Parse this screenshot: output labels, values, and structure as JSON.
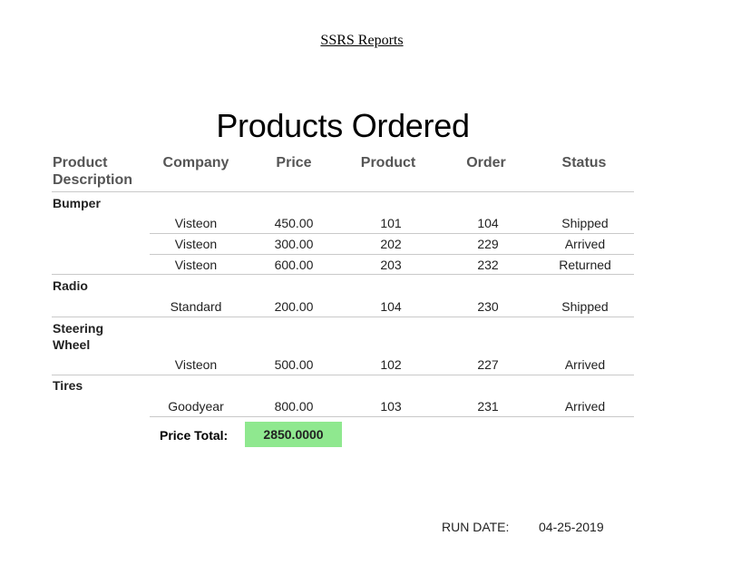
{
  "header": {
    "link_text": "SSRS Reports"
  },
  "report": {
    "title": "Products Ordered",
    "columns": {
      "description": "Product Description",
      "company": "Company",
      "price": "Price",
      "product": "Product",
      "order": "Order",
      "status": "Status"
    },
    "groups": [
      {
        "name": "Bumper",
        "rows": [
          {
            "company": "Visteon",
            "price": "450.00",
            "product": "101",
            "order": "104",
            "status": "Shipped"
          },
          {
            "company": "Visteon",
            "price": "300.00",
            "product": "202",
            "order": "229",
            "status": "Arrived"
          },
          {
            "company": "Visteon",
            "price": "600.00",
            "product": "203",
            "order": "232",
            "status": "Returned"
          }
        ]
      },
      {
        "name": "Radio",
        "rows": [
          {
            "company": "Standard",
            "price": "200.00",
            "product": "104",
            "order": "230",
            "status": "Shipped"
          }
        ]
      },
      {
        "name": "Steering Wheel",
        "rows": [
          {
            "company": "Visteon",
            "price": "500.00",
            "product": "102",
            "order": "227",
            "status": "Arrived"
          }
        ]
      },
      {
        "name": "Tires",
        "rows": [
          {
            "company": "Goodyear",
            "price": "800.00",
            "product": "103",
            "order": "231",
            "status": "Arrived"
          }
        ]
      }
    ],
    "total": {
      "label": "Price Total:",
      "value": "2850.0000",
      "highlight_color": "#8fe88f"
    },
    "run_date": {
      "label": "RUN DATE:",
      "value": "04-25-2019"
    }
  }
}
